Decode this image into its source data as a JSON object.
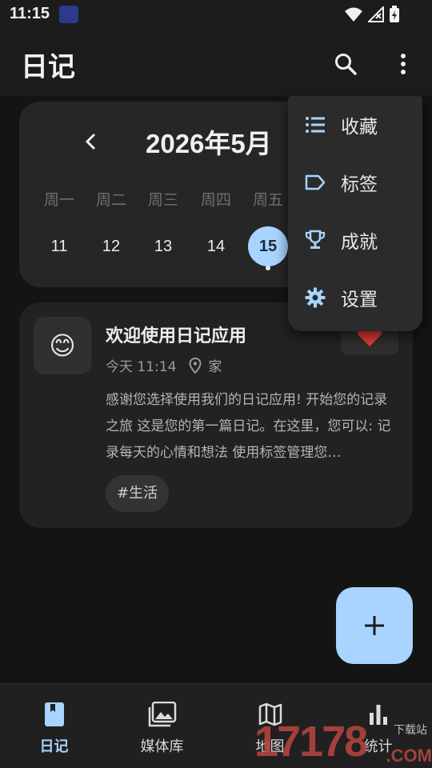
{
  "status_bar": {
    "time": "11:15"
  },
  "app_bar": {
    "title": "日记"
  },
  "calendar": {
    "month_label": "2026年5月",
    "weekdays": [
      "周一",
      "周二",
      "周三",
      "周四",
      "周五"
    ],
    "days": [
      "11",
      "12",
      "13",
      "14",
      "15"
    ],
    "selected_day": "15"
  },
  "entry": {
    "mood_emoji": "😊",
    "title": "欢迎使用日记应用",
    "time": "今天 11:14",
    "place": "家",
    "body": "感谢您选择使用我们的日记应用! 开始您的记录之旅 这是您的第一篇日记。在这里，您可以: 记录每天的心情和想法 使用标签管理您…",
    "tag": "#生活"
  },
  "menu": {
    "items": [
      {
        "label": "收藏",
        "icon": "list-icon"
      },
      {
        "label": "标签",
        "icon": "label-icon"
      },
      {
        "label": "成就",
        "icon": "trophy-icon"
      },
      {
        "label": "设置",
        "icon": "gear-icon"
      }
    ]
  },
  "bottom_nav": {
    "items": [
      {
        "label": "日记",
        "icon": "book-icon",
        "active": true
      },
      {
        "label": "媒体库",
        "icon": "photo-library-icon"
      },
      {
        "label": "地图",
        "icon": "map-icon"
      },
      {
        "label": "统计",
        "icon": "bar-chart-icon"
      }
    ]
  },
  "watermark": {
    "number": "17178",
    "text": "下载站",
    "domain": ".COM"
  },
  "colors": {
    "accent": "#a8d4ff",
    "background": "#141414",
    "card": "#262626",
    "heart": "#e53935"
  }
}
